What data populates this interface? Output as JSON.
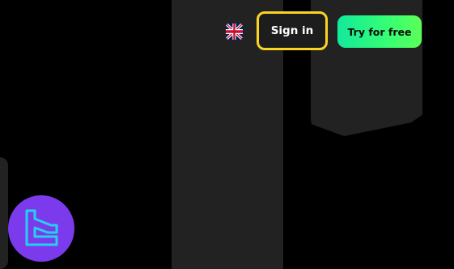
{
  "header": {
    "language_icon": "uk-flag-icon",
    "signin_label": "Sign in",
    "try_label": "Try for free"
  },
  "badge": {
    "icon": "tc-logo-icon"
  },
  "colors": {
    "background": "#000000",
    "panel": "#222222",
    "signin_border": "#f9d423",
    "try_gradient_start": "#13e99b",
    "try_gradient_end": "#5cff58",
    "badge": "#7c3aed",
    "badge_logo": "#22d3ee"
  }
}
